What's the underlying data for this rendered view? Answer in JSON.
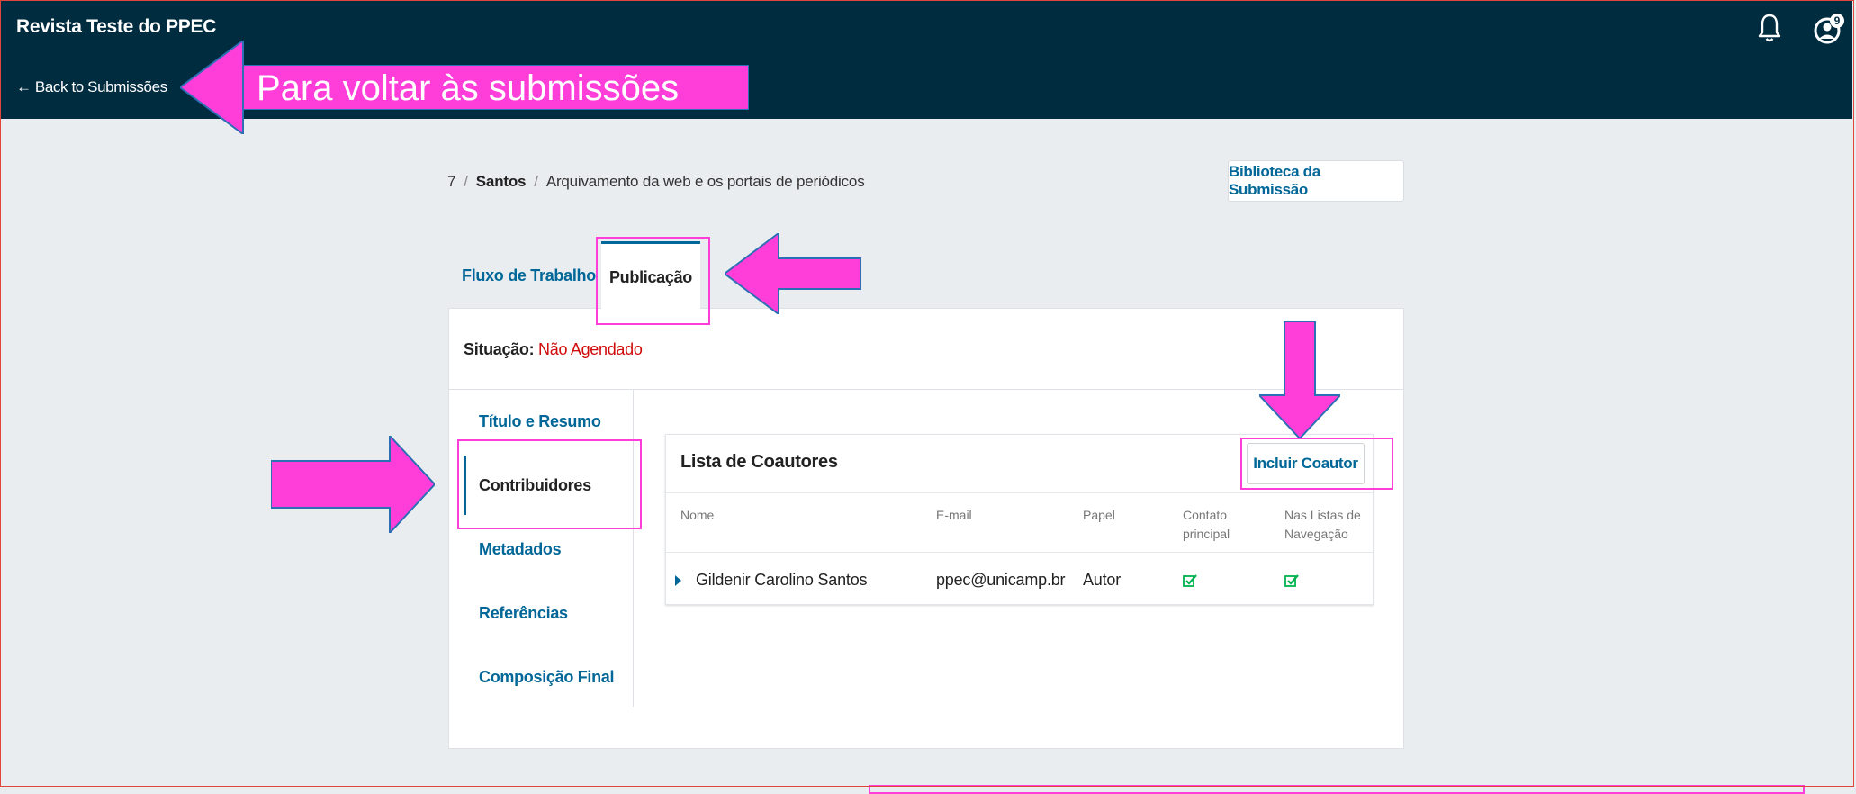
{
  "header": {
    "site_title": "Revista Teste do PPEC",
    "back_link": "← Back to Submissões",
    "notification_badge": "9"
  },
  "annotation": {
    "back_note": "Para voltar às submissões"
  },
  "breadcrumb": {
    "id": "7",
    "author": "Santos",
    "title": "Arquivamento da web e os portais de periódicos"
  },
  "toolbar": {
    "library_label": "Biblioteca da Submissão"
  },
  "tabs": [
    {
      "label": "Fluxo de Trabalho"
    },
    {
      "label": "Publicação"
    }
  ],
  "status": {
    "label": "Situação:",
    "value": "Não Agendado"
  },
  "sidebar": {
    "items": [
      {
        "label": "Título e Resumo"
      },
      {
        "label": "Contribuidores"
      },
      {
        "label": "Metadados"
      },
      {
        "label": "Referências"
      },
      {
        "label": "Composição Final"
      }
    ]
  },
  "coauthors": {
    "title": "Lista de Coautores",
    "add_label": "Incluir Coautor",
    "columns": [
      "Nome",
      "E-mail",
      "Papel",
      "Contato principal",
      "Nas Listas de Navegação"
    ],
    "rows": [
      {
        "name": "Gildenir Carolino Santos",
        "email": "ppec@unicamp.br",
        "role": "Autor",
        "primary_contact": true,
        "in_browse_lists": true
      }
    ]
  },
  "colors": {
    "topbar": "#002c40",
    "link": "#006798",
    "status_red": "#d00a0a",
    "annotation_pink": "#ff3dd8",
    "check_green": "#00b24e"
  }
}
